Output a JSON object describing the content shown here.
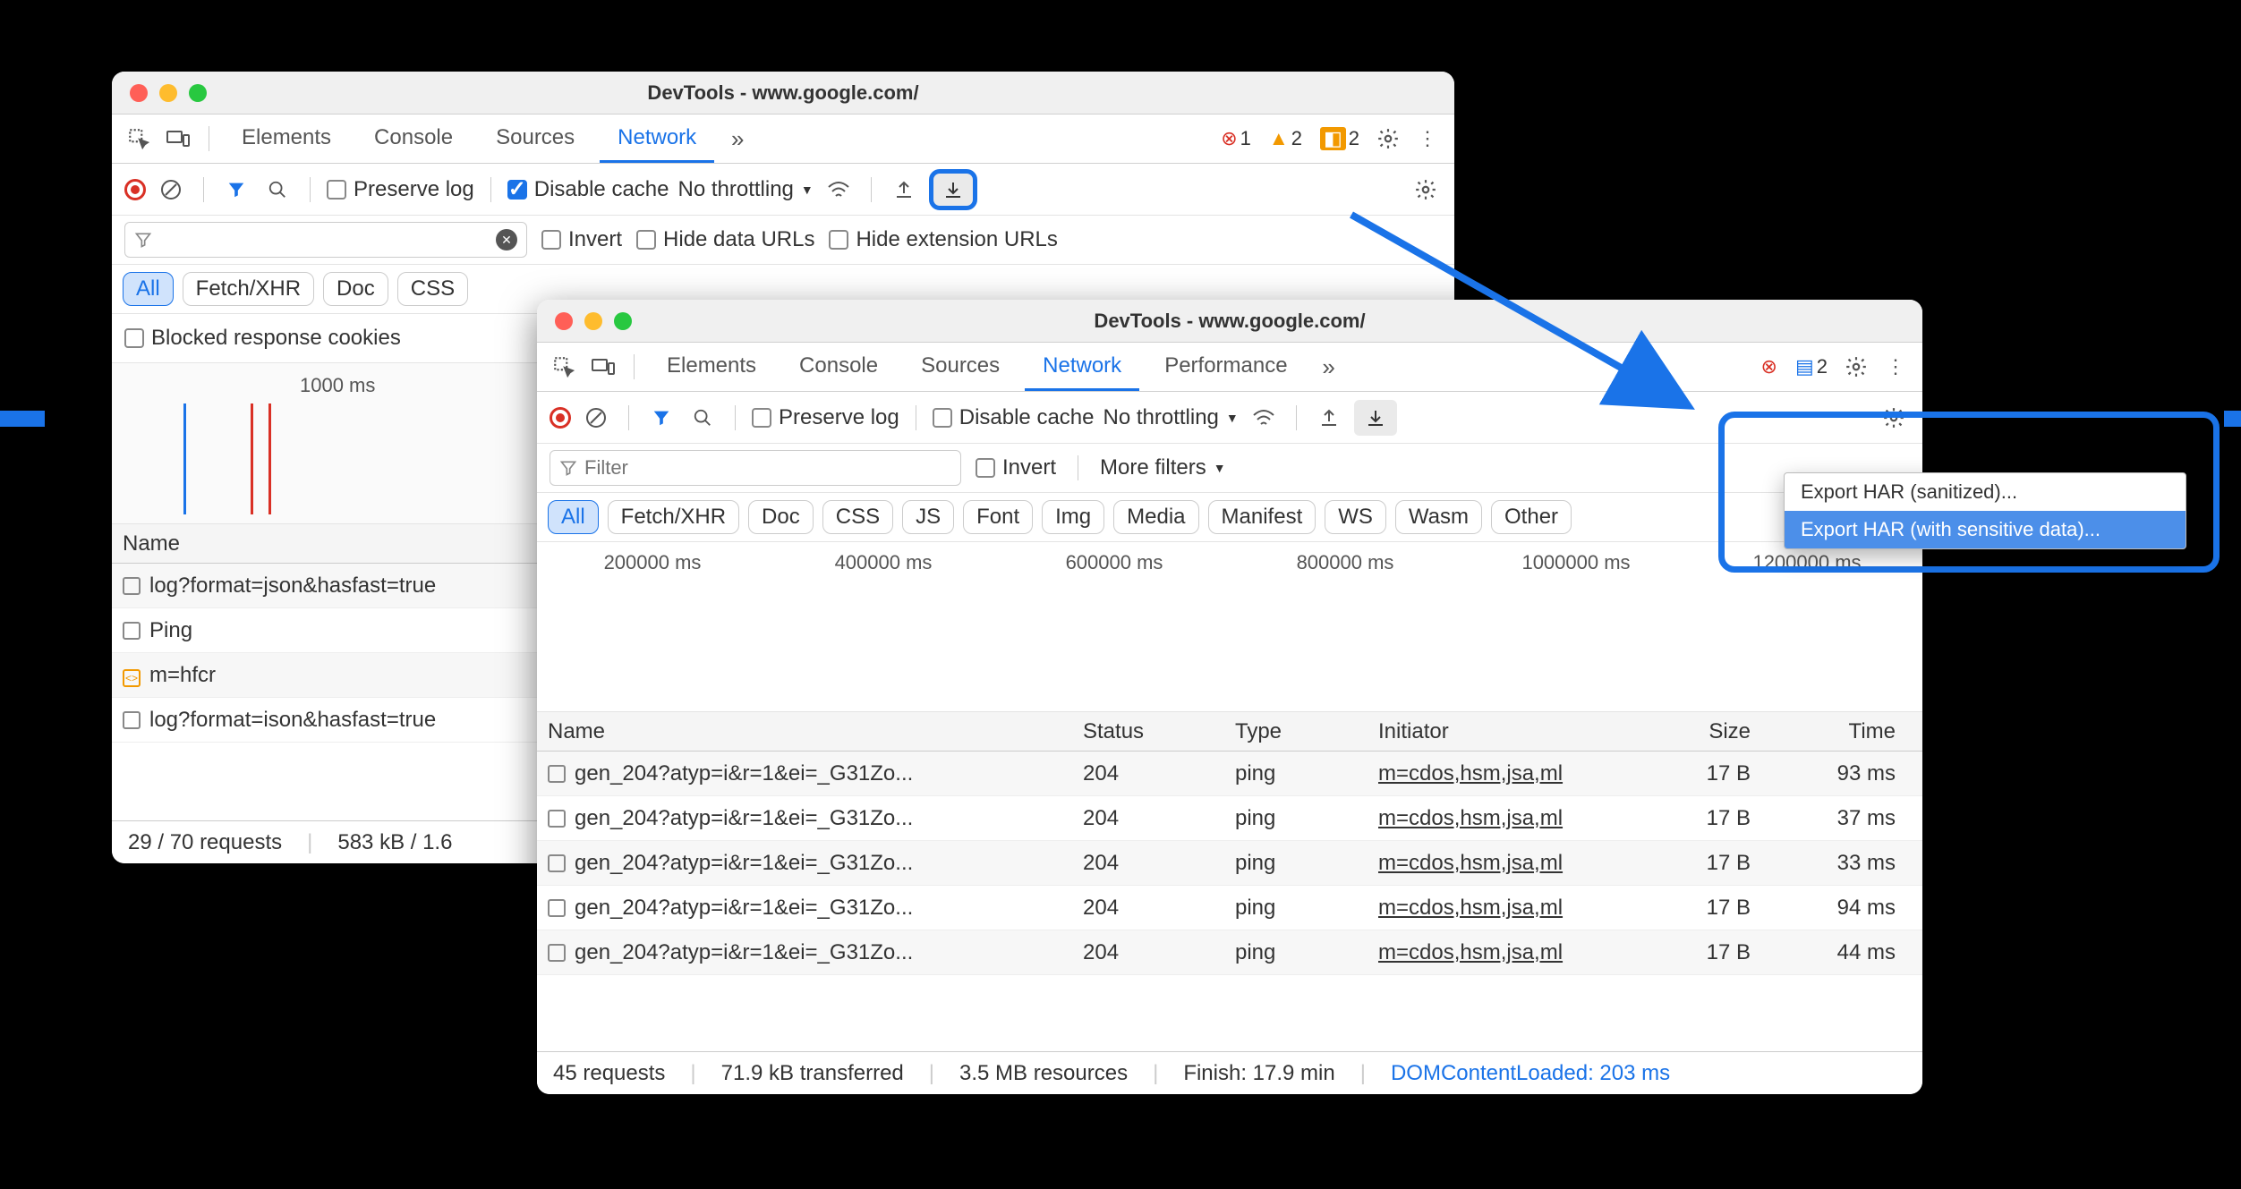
{
  "window1": {
    "title": "DevTools - www.google.com/",
    "tabs": [
      "Elements",
      "Console",
      "Sources",
      "Network"
    ],
    "activeTab": "Network",
    "badges": {
      "errors": "1",
      "warnings": "2",
      "issues": "2"
    },
    "toolbar": {
      "preserveLog": "Preserve log",
      "disableCache": "Disable cache",
      "throttling": "No throttling"
    },
    "filterbar": {
      "invert": "Invert",
      "hideData": "Hide data URLs",
      "hideExt": "Hide extension URLs"
    },
    "pills": [
      "All",
      "Fetch/XHR",
      "Doc",
      "CSS"
    ],
    "blockedRow": "Blocked response cookies",
    "waterfallLabel": "1000 ms",
    "nameHeader": "Name",
    "rows": [
      {
        "name": "log?format=json&hasfast=true"
      },
      {
        "name": "Ping"
      },
      {
        "name": "m=hfcr",
        "icon": "script"
      },
      {
        "name": "log?format=ison&hasfast=true"
      }
    ],
    "status": {
      "requests": "29 / 70 requests",
      "size": "583 kB / 1.6"
    }
  },
  "window2": {
    "title": "DevTools - www.google.com/",
    "tabs": [
      "Elements",
      "Console",
      "Sources",
      "Network",
      "Performance"
    ],
    "activeTab": "Network",
    "badges": {
      "issues": "2"
    },
    "toolbar": {
      "preserveLog": "Preserve log",
      "disableCache": "Disable cache",
      "throttling": "No throttling"
    },
    "filterbar": {
      "placeholder": "Filter",
      "invert": "Invert",
      "moreFilters": "More filters"
    },
    "pills": [
      "All",
      "Fetch/XHR",
      "Doc",
      "CSS",
      "JS",
      "Font",
      "Img",
      "Media",
      "Manifest",
      "WS",
      "Wasm",
      "Other"
    ],
    "waterfallLabels": [
      "200000 ms",
      "400000 ms",
      "600000 ms",
      "800000 ms",
      "1000000 ms",
      "1200000 ms"
    ],
    "columns": {
      "name": "Name",
      "status": "Status",
      "type": "Type",
      "initiator": "Initiator",
      "size": "Size",
      "time": "Time"
    },
    "rows": [
      {
        "name": "gen_204?atyp=i&r=1&ei=_G31Zo...",
        "status": "204",
        "type": "ping",
        "initiator": "m=cdos,hsm,jsa,ml",
        "size": "17 B",
        "time": "93 ms"
      },
      {
        "name": "gen_204?atyp=i&r=1&ei=_G31Zo...",
        "status": "204",
        "type": "ping",
        "initiator": "m=cdos,hsm,jsa,ml",
        "size": "17 B",
        "time": "37 ms"
      },
      {
        "name": "gen_204?atyp=i&r=1&ei=_G31Zo...",
        "status": "204",
        "type": "ping",
        "initiator": "m=cdos,hsm,jsa,ml",
        "size": "17 B",
        "time": "33 ms"
      },
      {
        "name": "gen_204?atyp=i&r=1&ei=_G31Zo...",
        "status": "204",
        "type": "ping",
        "initiator": "m=cdos,hsm,jsa,ml",
        "size": "17 B",
        "time": "94 ms"
      },
      {
        "name": "gen_204?atyp=i&r=1&ei=_G31Zo...",
        "status": "204",
        "type": "ping",
        "initiator": "m=cdos,hsm,jsa,ml",
        "size": "17 B",
        "time": "44 ms"
      }
    ],
    "status": {
      "requests": "45 requests",
      "transferred": "71.9 kB transferred",
      "resources": "3.5 MB resources",
      "finish": "Finish: 17.9 min",
      "dcl": "DOMContentLoaded: 203 ms"
    }
  },
  "menu": {
    "item1": "Export HAR (sanitized)...",
    "item2": "Export HAR (with sensitive data)..."
  }
}
